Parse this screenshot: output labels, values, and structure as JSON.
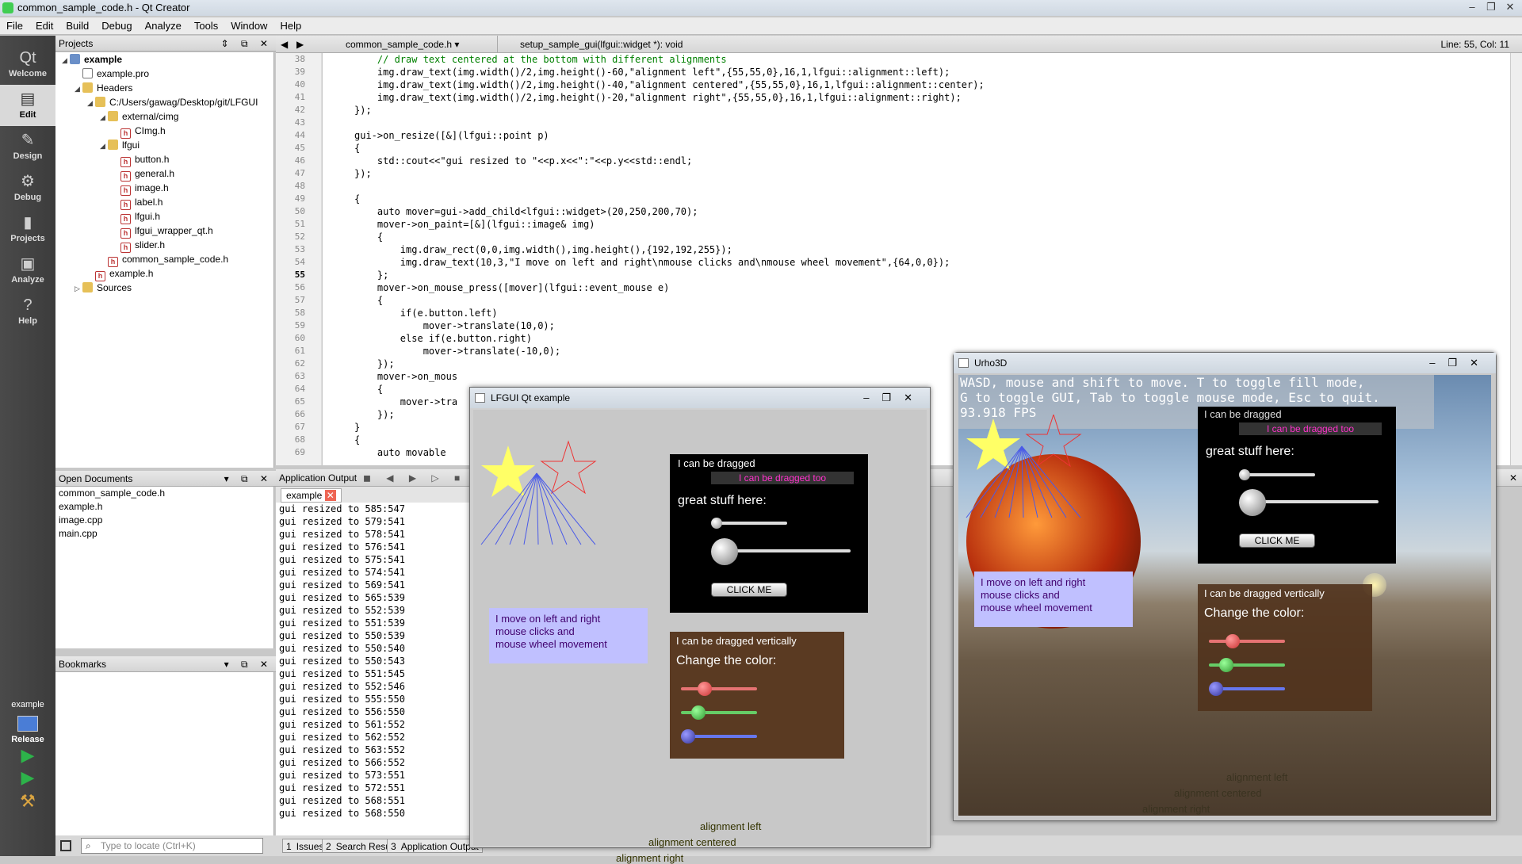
{
  "window": {
    "title": "common_sample_code.h - Qt Creator"
  },
  "menu": [
    "File",
    "Edit",
    "Build",
    "Debug",
    "Analyze",
    "Tools",
    "Window",
    "Help"
  ],
  "modes": [
    {
      "label": "Welcome",
      "icon": "qt-logo-icon"
    },
    {
      "label": "Edit",
      "icon": "document-icon"
    },
    {
      "label": "Design",
      "icon": "pencil-icon"
    },
    {
      "label": "Debug",
      "icon": "bug-icon"
    },
    {
      "label": "Projects",
      "icon": "wrench-icon"
    },
    {
      "label": "Analyze",
      "icon": "monitor-icon"
    },
    {
      "label": "Help",
      "icon": "help-icon"
    }
  ],
  "target": {
    "project": "example",
    "config": "Release"
  },
  "projects": {
    "header": "Projects",
    "tree": [
      {
        "label": "example",
        "level": 0,
        "type": "proj"
      },
      {
        "label": "example.pro",
        "level": 1,
        "type": "pro"
      },
      {
        "label": "Headers",
        "level": 1,
        "type": "folder"
      },
      {
        "label": "C:/Users/gawag/Desktop/git/LFGUI",
        "level": 2,
        "type": "folder"
      },
      {
        "label": "external/cimg",
        "level": 3,
        "type": "folder"
      },
      {
        "label": "CImg.h",
        "level": 4,
        "type": "h"
      },
      {
        "label": "lfgui",
        "level": 3,
        "type": "folder"
      },
      {
        "label": "button.h",
        "level": 4,
        "type": "h"
      },
      {
        "label": "general.h",
        "level": 4,
        "type": "h"
      },
      {
        "label": "image.h",
        "level": 4,
        "type": "h"
      },
      {
        "label": "label.h",
        "level": 4,
        "type": "h"
      },
      {
        "label": "lfgui.h",
        "level": 4,
        "type": "h"
      },
      {
        "label": "lfgui_wrapper_qt.h",
        "level": 4,
        "type": "h"
      },
      {
        "label": "slider.h",
        "level": 4,
        "type": "h"
      },
      {
        "label": "common_sample_code.h",
        "level": 3,
        "type": "h"
      },
      {
        "label": "example.h",
        "level": 2,
        "type": "h"
      },
      {
        "label": "Sources",
        "level": 1,
        "type": "folder"
      }
    ]
  },
  "openDocuments": {
    "header": "Open Documents",
    "items": [
      "common_sample_code.h",
      "example.h",
      "image.cpp",
      "main.cpp"
    ]
  },
  "bookmarks": {
    "header": "Bookmarks"
  },
  "editor": {
    "file": "common_sample_code.h",
    "function": "setup_sample_gui(lfgui::widget *): void",
    "position": "Line: 55, Col: 11",
    "firstLine": 38,
    "lines": [
      "    // draw text centered at the bottom with different alignments",
      "    img.draw_text(img.width()/2,img.height()-60,\"alignment left\",{55,55,0},16,1,lfgui::alignment::left);",
      "    img.draw_text(img.width()/2,img.height()-40,\"alignment centered\",{55,55,0},16,1,lfgui::alignment::center);",
      "    img.draw_text(img.width()/2,img.height()-20,\"alignment right\",{55,55,0},16,1,lfgui::alignment::right);",
      "});",
      "",
      "gui->on_resize([&](lfgui::point p)",
      "{",
      "    std::cout<<\"gui resized to \"<<p.x<<\":\"<<p.y<<std::endl;",
      "});",
      "",
      "{",
      "    auto mover=gui->add_child<lfgui::widget>(20,250,200,70);",
      "    mover->on_paint=[&](lfgui::image& img)",
      "    {",
      "        img.draw_rect(0,0,img.width(),img.height(),{192,192,255});",
      "        img.draw_text(10,3,\"I move on left and right\\nmouse clicks and\\nmouse wheel movement\",{64,0,0});",
      "    };",
      "    mover->on_mouse_press([mover](lfgui::event_mouse e)",
      "    {",
      "        if(e.button.left)",
      "            mover->translate(10,0);",
      "        else if(e.button.right)",
      "            mover->translate(-10,0);",
      "    });",
      "    mover->on_mous",
      "    {",
      "        mover->tra",
      "    });",
      "}",
      "{",
      "    auto movable"
    ]
  },
  "output": {
    "header": "Application Output",
    "tab": "example",
    "lines": [
      "gui resized to 585:547",
      "gui resized to 579:541",
      "gui resized to 578:541",
      "gui resized to 576:541",
      "gui resized to 575:541",
      "gui resized to 574:541",
      "gui resized to 569:541",
      "gui resized to 565:539",
      "gui resized to 552:539",
      "gui resized to 551:539",
      "gui resized to 550:539",
      "gui resized to 550:540",
      "gui resized to 550:543",
      "gui resized to 551:545",
      "gui resized to 552:546",
      "gui resized to 555:550",
      "gui resized to 556:550",
      "gui resized to 561:552",
      "gui resized to 562:552",
      "gui resized to 563:552",
      "gui resized to 566:552",
      "gui resized to 573:551",
      "gui resized to 572:551",
      "gui resized to 568:551",
      "gui resized to 568:550"
    ]
  },
  "statusbar": {
    "locate_placeholder": "Type to locate (Ctrl+K)",
    "tabs": [
      {
        "num": "1",
        "label": "Issues"
      },
      {
        "num": "2",
        "label": "Search Results"
      },
      {
        "num": "3",
        "label": "Application Output"
      }
    ]
  },
  "lfgui": {
    "title": "LFGUI Qt example",
    "drag": "I can be dragged",
    "drag_too": "I can be dragged too",
    "great": "great stuff here:",
    "click": "CLICK ME",
    "mover": [
      "I move on left and right",
      "mouse clicks and",
      "mouse wheel movement"
    ],
    "vertical": "I can be dragged vertically",
    "color": "Change the color:",
    "align_left": "alignment left",
    "align_center": "alignment centered",
    "align_right": "alignment right"
  },
  "urho": {
    "title": "Urho3D",
    "info1": "WASD, mouse and shift to move. T to toggle fill mode,",
    "info2": "G to toggle GUI, Tab to toggle mouse mode, Esc to quit.",
    "fps": "93.918 FPS"
  }
}
